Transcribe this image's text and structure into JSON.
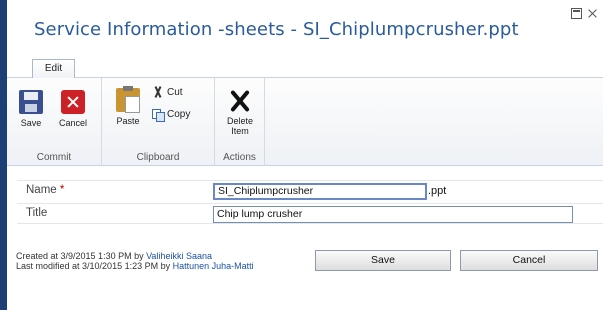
{
  "window": {
    "title": "Service Information -sheets - SI_Chiplumpcrusher.ppt"
  },
  "ribbon": {
    "active_tab": "Edit",
    "groups": {
      "commit": {
        "label": "Commit",
        "save_label": "Save",
        "cancel_label": "Cancel"
      },
      "clipboard": {
        "label": "Clipboard",
        "paste_label": "Paste",
        "cut_label": "Cut",
        "copy_label": "Copy"
      },
      "actions": {
        "label": "Actions",
        "delete_label_line1": "Delete",
        "delete_label_line2": "Item"
      }
    }
  },
  "form": {
    "name_label": "Name",
    "required_marker": "*",
    "name_value": "SI_Chiplumpcrusher",
    "name_extension": ".ppt",
    "title_label": "Title",
    "title_value": "Chip lump crusher"
  },
  "meta": {
    "created_prefix": "Created at 3/9/2015 1:30 PM by ",
    "created_by": "Valiheikki Saana",
    "modified_prefix": "Last modified at 3/10/2015 1:23 PM by ",
    "modified_by": "Hattunen Juha-Matti"
  },
  "buttons": {
    "save": "Save",
    "cancel": "Cancel"
  }
}
